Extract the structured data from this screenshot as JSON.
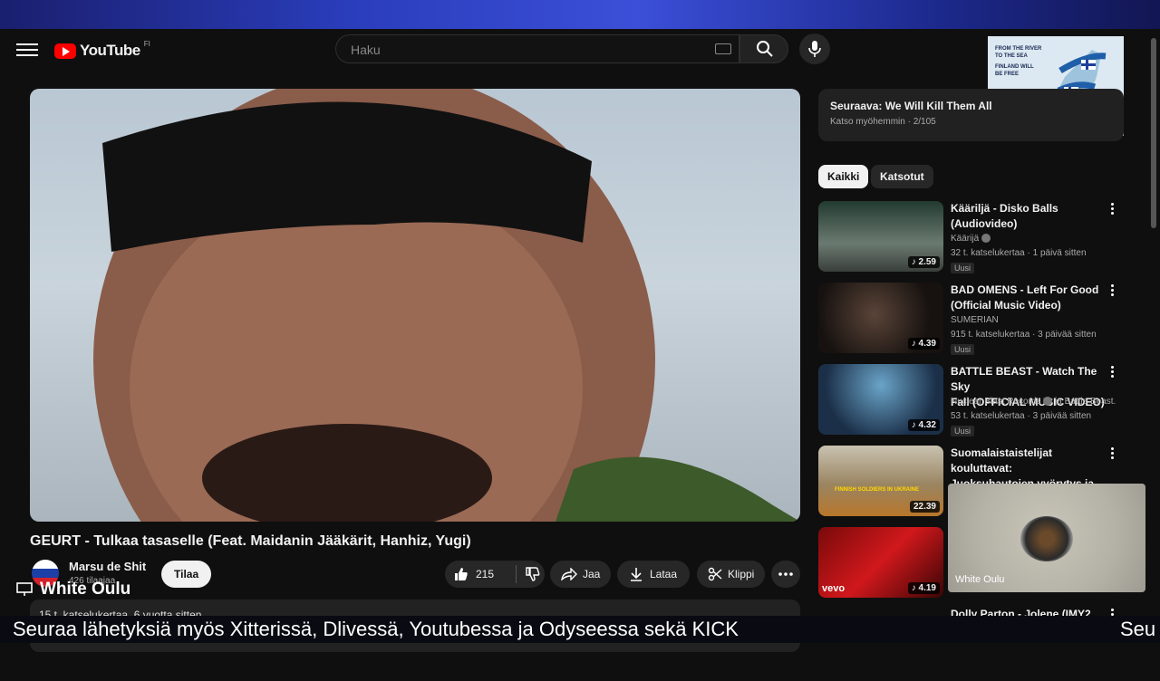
{
  "header": {
    "brand": "YouTube",
    "country": "FI",
    "search_placeholder": "Haku"
  },
  "overlay_map": {
    "line1": "FROM THE RIVER",
    "line2": "TO THE SEA",
    "line3": "FINLAND WILL",
    "line4": "BE FREE"
  },
  "video": {
    "title": "GEURT - Tulkaa tasaselle (Feat. Maidanin Jääkärit, Hanhiz, Yugi)",
    "channel": "Marsu de Shit",
    "subscribers": "426 tilaajaa",
    "subscribe_label": "Tilaa",
    "likes": "215",
    "share_label": "Jaa",
    "download_label": "Lataa",
    "clip_label": "Klippi",
    "views": "15 t. katselukertaa",
    "age": "6 vuotta sitten"
  },
  "playlist": {
    "next_label": "Seuraava: We Will Kill Them All",
    "source": "Katso myöhemmin",
    "position": "2/105"
  },
  "chips": {
    "all": "Kaikki",
    "watched": "Katsotut"
  },
  "recommendations": [
    {
      "title_line1": "Kääriljä - Disko Balls",
      "title_line2": "(Audiovideo)",
      "channel": "Käärijä",
      "meta": "32 t. katselukertaa · 1 päivä sitten",
      "badge": "Uusi",
      "duration": "2.59"
    },
    {
      "title_line1": "BAD OMENS - Left For Good",
      "title_line2": "(Official Music Video)",
      "channel": "SUMERIAN",
      "meta": "915 t. katselukertaa · 3 päivää sitten",
      "badge": "Uusi",
      "duration": "4.39"
    },
    {
      "title_line1": "BATTLE BEAST - Watch The Sky",
      "title_line2": "Fall (OFFICIAL MUSIC VIDEO)",
      "channel": "Nuclear Blast Records",
      "channel_extra": "ja Battle Beast.",
      "meta": "53 t. katselukertaa · 3 päivää sitten",
      "badge": "Uusi",
      "duration": "4.32"
    },
    {
      "title_line1": "Suomalaistaistelijat kouluttavat:",
      "title_line2": "Juoksuhautojen vyörytys ja ...",
      "thumb_text": "FINNISH SOLDIERS IN UKRAINE",
      "duration": "22.39"
    },
    {
      "duration": "4.19",
      "vevo": "vevo"
    },
    {
      "title_line1": "Dolly Parton - Jolene (IMY2"
    }
  ],
  "stream": {
    "cam_name": "White Oulu",
    "label": "White Oulu",
    "ticker": "Seuraa lähetyksiä myös Xitterissä, Dlivessä, Youtubessa ja Odyseessa sekä KICK",
    "ticker_repeat": "Seu"
  },
  "colors": {
    "background": "#0f0f0f",
    "brand_red": "#ff0000",
    "chip_active": "#f1f1f1"
  }
}
